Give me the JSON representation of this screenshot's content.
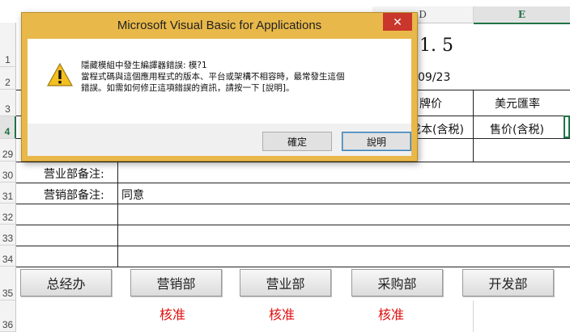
{
  "sheet": {
    "column_headers": [
      "D",
      "E"
    ],
    "row_headers": [
      "1",
      "2",
      "3",
      "4",
      "29",
      "30",
      "31",
      "32",
      "33",
      "34",
      "35",
      "36"
    ],
    "title_fragment": "1. 5",
    "date_fragment": "09/23",
    "d3": "牌价",
    "e3": "美元匯率",
    "d4": "成本(含税)",
    "e4": "售价(含税)",
    "sales_note_label": "营业部备注:",
    "marketing_note_label": "营销部备注:",
    "marketing_note_value": "同意",
    "buttons": [
      "总经办",
      "营销部",
      "营业部",
      "采购部",
      "开发部"
    ],
    "approve": [
      "核准",
      "核准",
      "核准"
    ]
  },
  "dialog": {
    "title": "Microsoft Visual Basic for Applications",
    "close": "✕",
    "message_lines": [
      "隱藏模組中發生編譯器錯誤: 模?1",
      "當程式碼與這個應用程式的版本、平台或架構不相容時，最常發生這個",
      "錯誤。如需如何修正這項錯誤的資訊，請按一下 [說明]。"
    ],
    "ok": "確定",
    "help": "說明",
    "icon": "warning-icon"
  }
}
